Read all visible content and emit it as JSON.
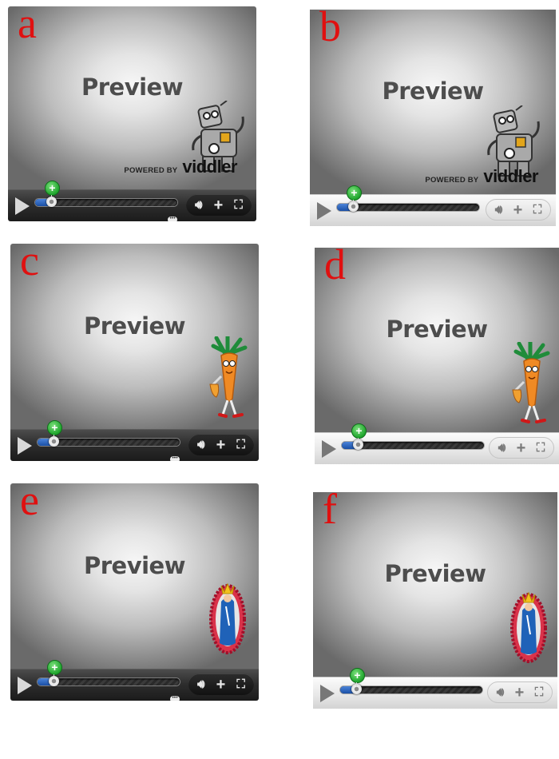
{
  "players": [
    {
      "letter": "a",
      "theme": "dark",
      "mascot": "robot-icon",
      "has_branding": true
    },
    {
      "letter": "b",
      "theme": "light",
      "mascot": "robot-icon",
      "has_branding": true
    },
    {
      "letter": "c",
      "theme": "dark",
      "mascot": "carrot-icon",
      "has_branding": false
    },
    {
      "letter": "d",
      "theme": "light",
      "mascot": "carrot-icon",
      "has_branding": false
    },
    {
      "letter": "e",
      "theme": "dark",
      "mascot": "saint-medallion-icon",
      "has_branding": false
    },
    {
      "letter": "f",
      "theme": "light",
      "mascot": "saint-medallion-icon",
      "has_branding": false
    }
  ],
  "preview_label": "Preview",
  "powered_by_label": "POWERED BY",
  "brand_name": "viddler",
  "icons": {
    "play": "play-icon",
    "comment": "comment-icon",
    "volume": "volume-icon",
    "add": "add-icon",
    "fullscreen": "fullscreen-icon",
    "marker": "add-comment-marker-icon"
  },
  "colors": {
    "letter": "#e01010",
    "progress": "#2f6ac4",
    "marker": "#2bb23a"
  }
}
